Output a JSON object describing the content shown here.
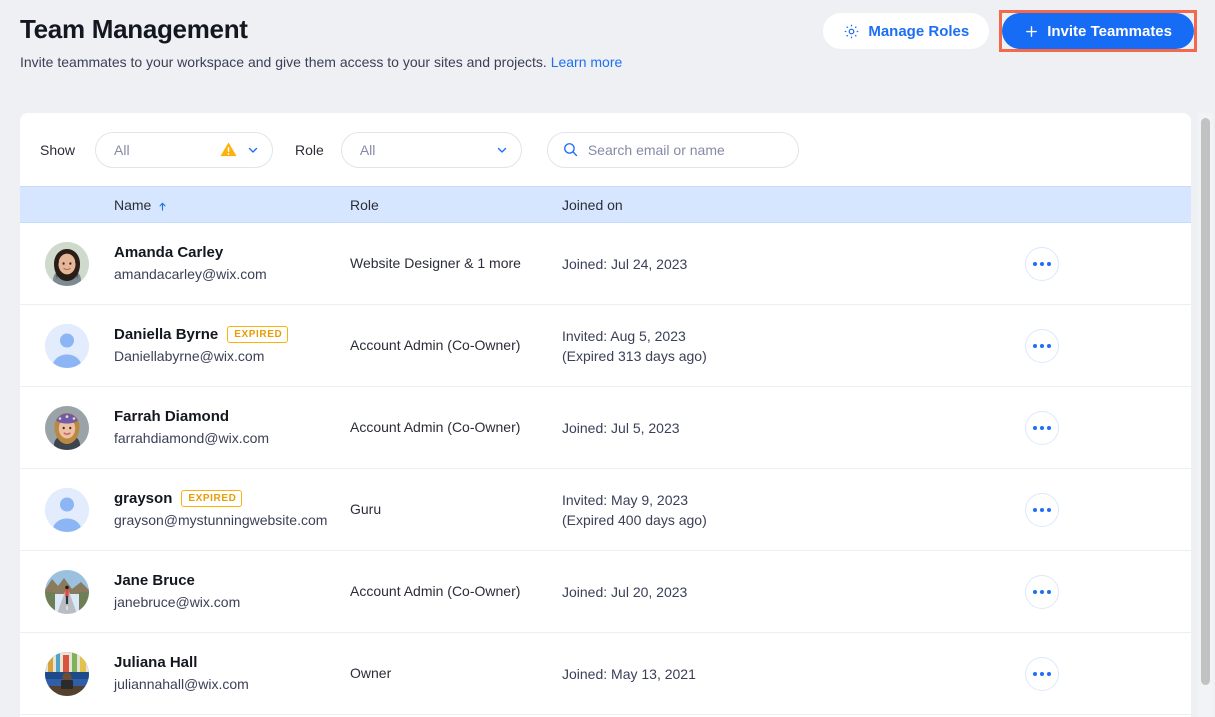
{
  "header": {
    "title": "Team Management",
    "subtitle": "Invite teammates to your workspace and give them access to your sites and projects.",
    "learn_more": "Learn more",
    "manage_roles_label": "Manage Roles",
    "invite_label": "Invite Teammates",
    "gear_icon": "gear-icon",
    "plus_icon": "plus-icon",
    "highlight_color": "#f4694c",
    "primary_color": "#176cf5",
    "link_color": "#1d6ff5"
  },
  "filters": {
    "show_label": "Show",
    "show_value": "All",
    "show_warning_icon": "warning-triangle-icon",
    "role_label": "Role",
    "role_value": "All",
    "chevron_icon": "chevron-down-icon",
    "search_placeholder": "Search email or name",
    "search_value": "",
    "search_icon": "search-icon"
  },
  "table": {
    "columns": {
      "name": "Name",
      "role": "Role",
      "joined": "Joined on"
    },
    "sort_column": "Name",
    "sort_direction": "asc",
    "sort_icon": "arrow-up-icon",
    "header_bg": "#d6e6fe",
    "more_icon": "ellipsis-icon",
    "rows": [
      {
        "name": "Amanda Carley",
        "email": "amandacarley@wix.com",
        "badge": "",
        "role": "Website Designer & 1 more",
        "joined": "Joined: Jul 24, 2023",
        "joined_sub": "",
        "avatar": "photo-woman-dark-hair"
      },
      {
        "name": "Daniella Byrne",
        "email": "Daniellabyrne@wix.com",
        "badge": "EXPIRED",
        "role": "Account Admin (Co-Owner)",
        "joined": "Invited: Aug 5, 2023",
        "joined_sub": "(Expired 313 days ago)",
        "avatar": "placeholder-person"
      },
      {
        "name": "Farrah Diamond",
        "email": "farrahdiamond@wix.com",
        "badge": "",
        "role": "Account Admin (Co-Owner)",
        "joined": "Joined: Jul 5, 2023",
        "joined_sub": "",
        "avatar": "photo-woman-headband"
      },
      {
        "name": "grayson",
        "email": "grayson@mystunningwebsite.com",
        "badge": "EXPIRED",
        "role": "Guru",
        "joined": "Invited: May 9, 2023",
        "joined_sub": "(Expired 400 days ago)",
        "avatar": "placeholder-person"
      },
      {
        "name": "Jane Bruce",
        "email": "janebruce@wix.com",
        "badge": "",
        "role": "Account Admin (Co-Owner)",
        "joined": "Joined: Jul 20, 2023",
        "joined_sub": "",
        "avatar": "photo-person-road"
      },
      {
        "name": "Juliana Hall",
        "email": "juliannahall@wix.com",
        "badge": "",
        "role": "Owner",
        "joined": "Joined: May 13, 2021",
        "joined_sub": "",
        "avatar": "photo-person-desk"
      }
    ]
  },
  "scrollbar": {
    "orientation": "vertical",
    "position": "top"
  }
}
